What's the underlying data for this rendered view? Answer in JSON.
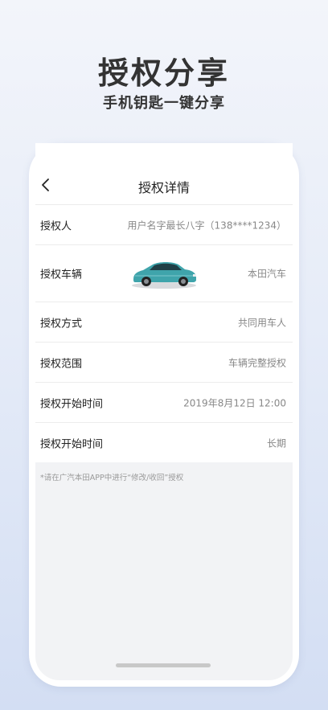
{
  "promo": {
    "headline": "授权分享",
    "subline": "手机钥匙一键分享"
  },
  "nav": {
    "title": "授权详情",
    "back_icon": "chevron-left-icon"
  },
  "rows": [
    {
      "label": "授权人",
      "value": "用户名字最长八字（138****1234）"
    },
    {
      "label": "授权车辆",
      "value": "本田汽车",
      "image": "car-image"
    },
    {
      "label": "授权方式",
      "value": "共同用车人"
    },
    {
      "label": "授权范围",
      "value": "车辆完整授权"
    },
    {
      "label": "授权开始时间",
      "value": "2019年8月12日  12:00"
    },
    {
      "label": "授权开始时间",
      "value": "长期"
    }
  ],
  "note": "*请在广汽本田APP中进行“修改/收回”授权",
  "colors": {
    "background_top": "#f3f5fa",
    "background_bottom": "#d3def3",
    "car_body": "#3fa4ab"
  }
}
